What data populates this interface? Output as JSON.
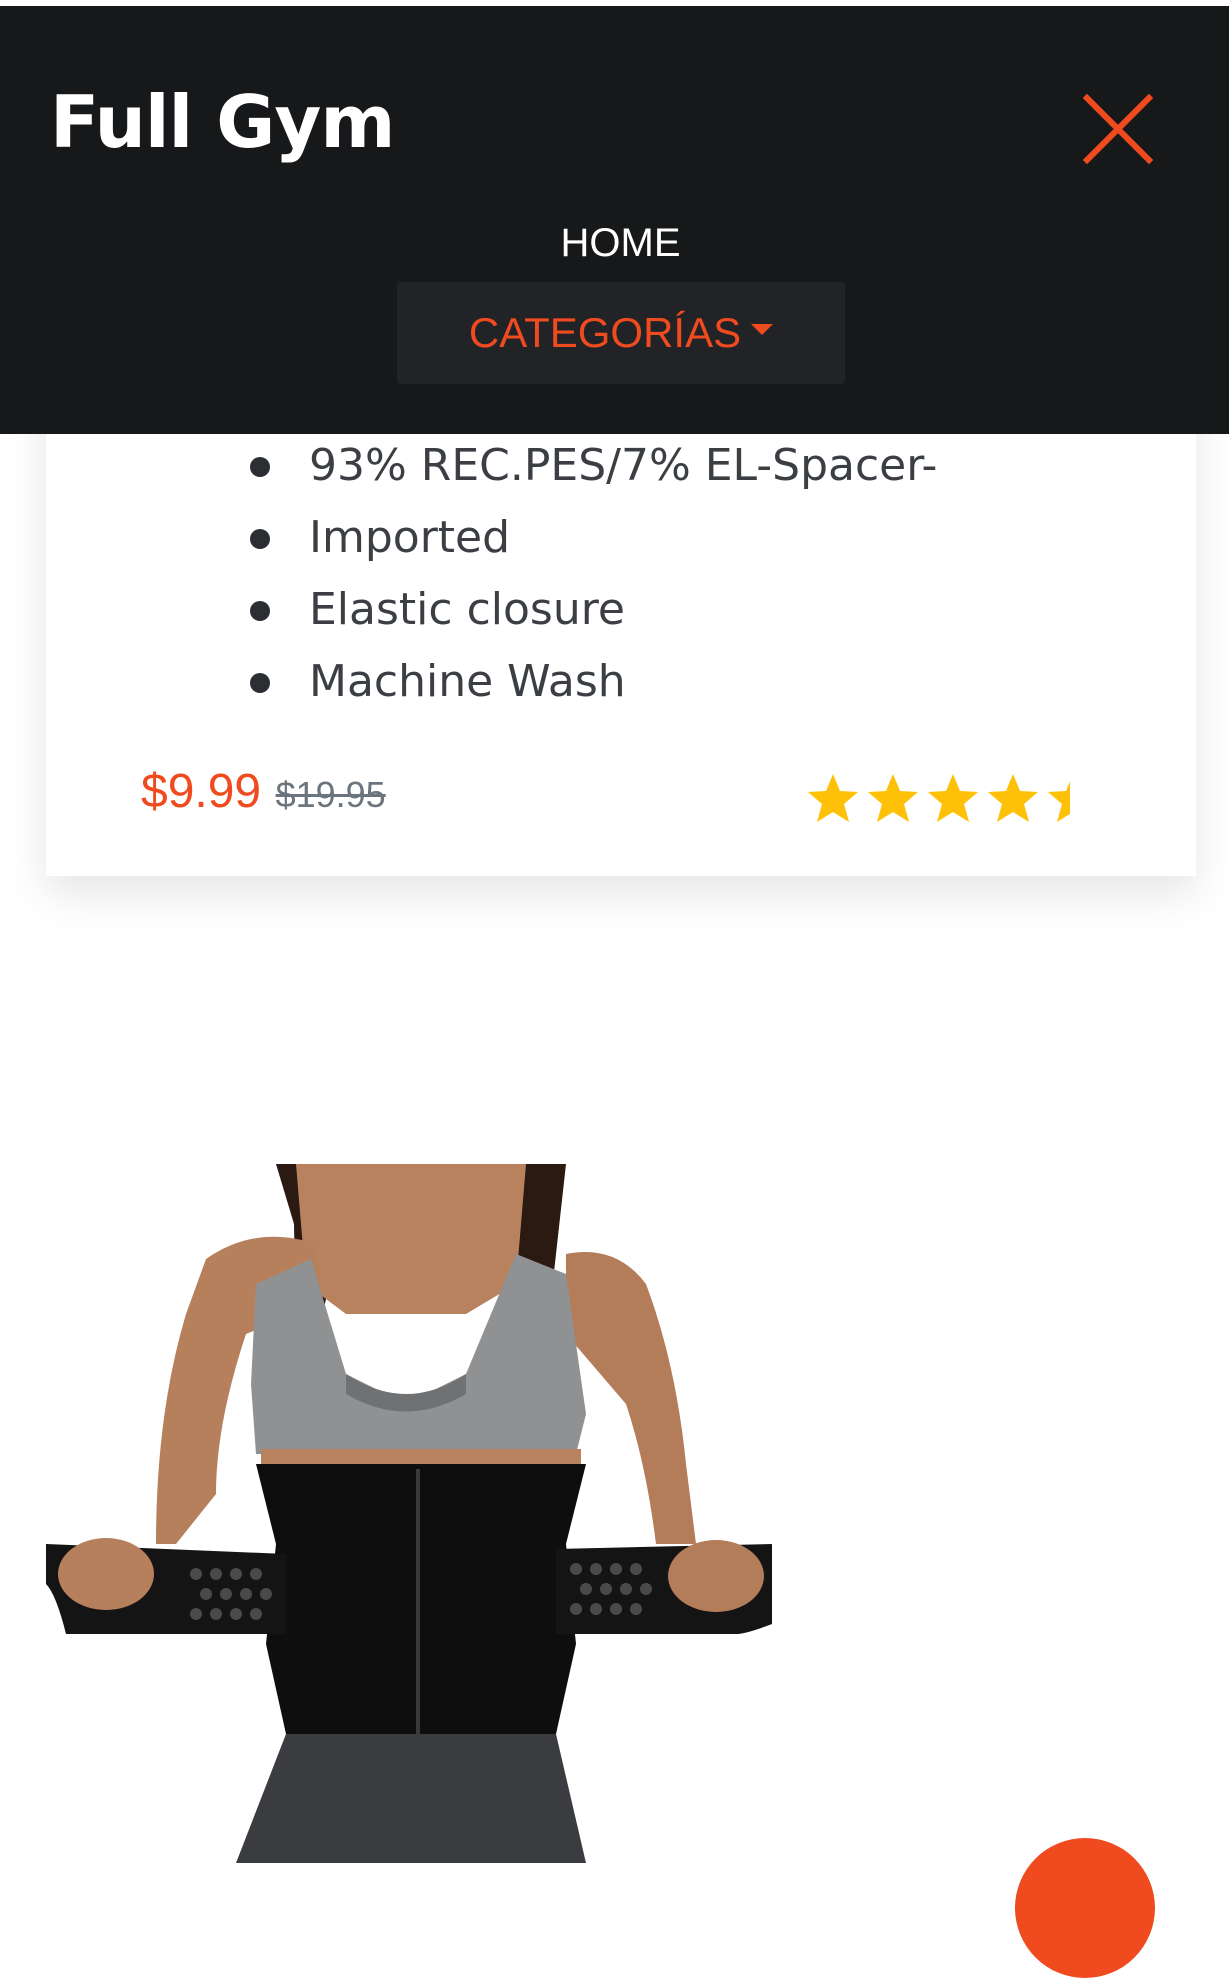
{
  "header": {
    "brand": "Full Gym",
    "close_icon": "close-icon",
    "nav": {
      "home_label": "HOME",
      "categories_label": "CATEGORÍAS",
      "categories_icon": "caret-down-icon"
    }
  },
  "product": {
    "features": [
      "93% REC.PES/7% EL-Spacer-",
      "Imported",
      "Elastic closure",
      "Machine Wash"
    ],
    "price": "$9.99",
    "original_price": "$19.95",
    "rating": 4.5,
    "rating_max": 5,
    "rating_icon": "star-icon"
  },
  "image": {
    "subject": "woman wearing black waist trainer belt"
  },
  "fab": {
    "icon": "fab-button"
  },
  "colors": {
    "header_bg": "#17181a",
    "accent": "#f04a1f",
    "star": "#ffc107",
    "text": "#3b3f44",
    "muted": "#6c757d"
  }
}
